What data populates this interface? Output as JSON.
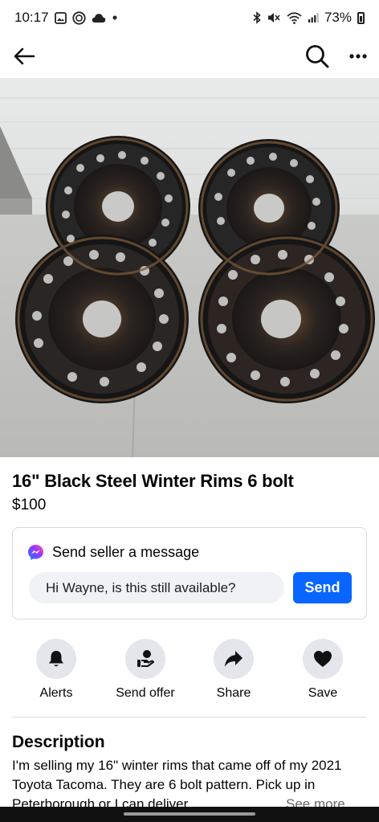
{
  "status_bar": {
    "time": "10:17",
    "battery": "73%",
    "icons_left": [
      "gallery-icon",
      "messenger-status-icon",
      "cloud-icon",
      "notification-dot-icon"
    ],
    "icons_right": [
      "bluetooth-icon",
      "mute-icon",
      "wifi-icon",
      "signal-icon",
      "battery-icon"
    ]
  },
  "nav": {
    "back_icon": "arrow-left-icon",
    "search_icon": "search-icon",
    "more_icon": "more-horizontal-icon"
  },
  "photo": {
    "description_icon": "listing-photo",
    "carousel_count": 4,
    "carousel_active": 0
  },
  "listing": {
    "title": "16\" Black Steel Winter Rims 6 bolt",
    "price": "$100"
  },
  "message": {
    "header": "Send seller a message",
    "input_value": "Hi Wayne, is this still available?",
    "send_label": "Send",
    "accent": "#0866ff"
  },
  "actions": [
    {
      "label": "Alerts",
      "icon": "bell-icon"
    },
    {
      "label": "Send offer",
      "icon": "offer-icon"
    },
    {
      "label": "Share",
      "icon": "share-arrow-icon"
    },
    {
      "label": "Save",
      "icon": "heart-icon"
    }
  ],
  "description": {
    "title": "Description",
    "text": "I'm selling my 16\" winter rims that came off of my 2021 Toyota Tacoma. They are 6 bolt pattern. Pick up in Peterborough or I can deliver.",
    "see_more": "See more"
  }
}
